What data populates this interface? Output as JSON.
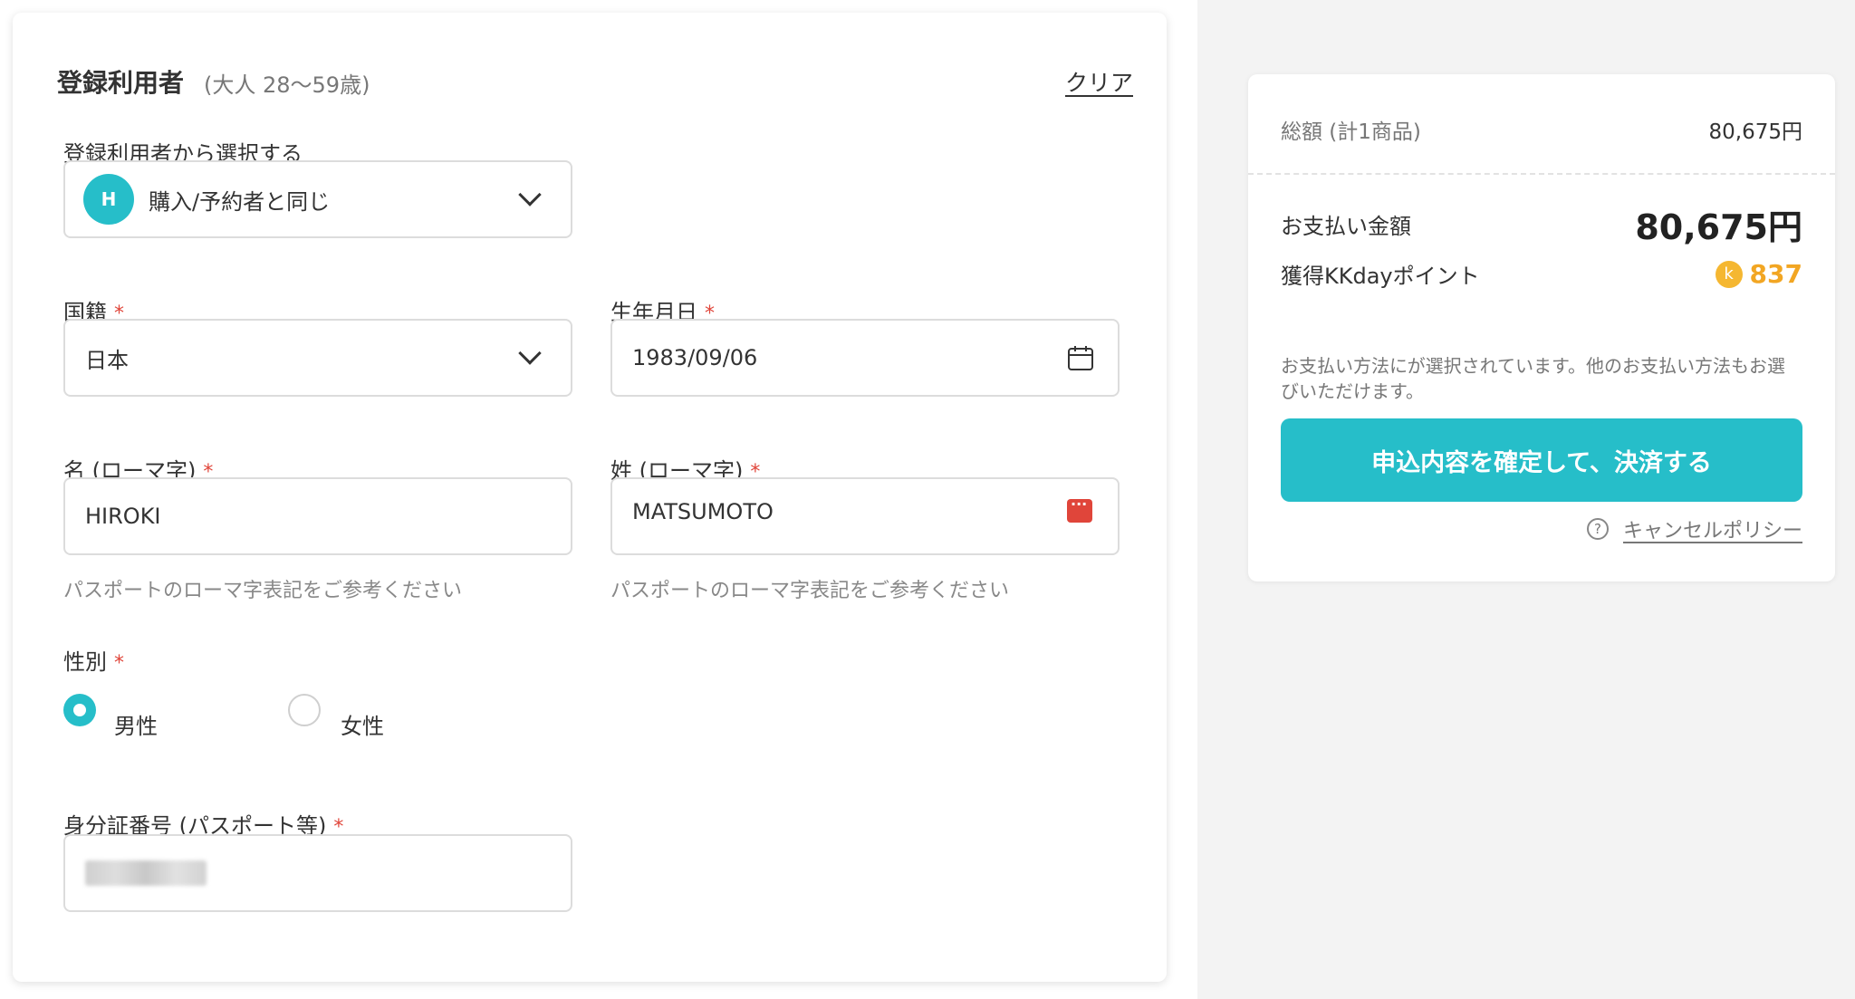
{
  "traveler": {
    "title": "登録利用者",
    "subtitle": "(大人 28〜59歳)",
    "clear_label": "クリア",
    "select_label": "登録利用者から選択する",
    "select_avatar": "H",
    "select_value": "購入/予約者と同じ",
    "required_mark": "*",
    "nationality_label": "国籍",
    "nationality_value": "日本",
    "birthdate_label": "生年月日",
    "birthdate_value": "1983/09/06",
    "firstname_label": "名 (ローマ字)",
    "firstname_value": "HIROKI",
    "lastname_label": "姓 (ローマ字)",
    "lastname_value": "MATSUMOTO",
    "name_hint": "パスポートのローマ字表記をご参考ください",
    "gender_label": "性別",
    "gender_options": [
      {
        "label": "男性",
        "checked": true
      },
      {
        "label": "女性",
        "checked": false
      }
    ],
    "id_label": "身分証番号 (パスポート等)"
  },
  "summary": {
    "total_label": "総額 (計1商品)",
    "total_value": "80,675円",
    "pay_label": "お支払い金額",
    "pay_amount": "80,675円",
    "points_label": "獲得KKdayポイント",
    "points_icon": "k",
    "points_value": "837",
    "notice": "お支払い方法にが選択されています。他のお支払い方法もお選びいただけます。",
    "confirm_label": "申込内容を確定して、決済する",
    "cancel_icon": "?",
    "cancel_label": "キャンセルポリシー"
  },
  "colors": {
    "accent": "#26bec9",
    "required": "#e0453a",
    "points": "#f2a623"
  }
}
